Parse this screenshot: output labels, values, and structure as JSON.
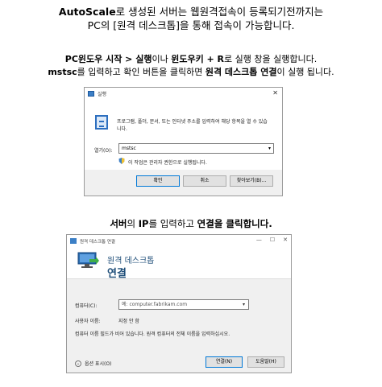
{
  "intro": {
    "line1_bold": "AutoScale",
    "line1_rest": "로 생성된 서버는 웹원격접속이 등록되기전까지는",
    "line2": "PC의 [원격 데스크톱]을 통해 접속이 가능합니다."
  },
  "step1": {
    "p1": "PC윈도우 시작 > 실행",
    "p2": "이나 ",
    "p3": "윈도우키 + R",
    "p4": "로 실행 창을 실행합니다.",
    "p5": "mstsc",
    "p6": "를 입력하고 확인 버튼을 클릭하면 ",
    "p7": "원격 데스크톱 연결",
    "p8": "이 실행 됩니다."
  },
  "run_dialog": {
    "title": "실행",
    "close": "✕",
    "description": "프로그램, 폴더, 문서, 또는 인터넷 주소를 입력하여 해당 항목을 열 수 있습니다.",
    "open_label": "열기(O):",
    "open_value": "mstsc",
    "admin_note": "이 작업은 관리자 권한으로 실행됩니다.",
    "ok": "확인",
    "cancel": "취소",
    "browse": "찾아보기(B)..."
  },
  "step2": {
    "p1": "서버",
    "p2": "의 ",
    "p3": "IP",
    "p4": "를 입력하고 ",
    "p5": "연결을 클릭합니다."
  },
  "rdp_dialog": {
    "title": "원격 데스크톱 연결",
    "minimize": "—",
    "maximize": "☐",
    "close": "✕",
    "heading1": "원격 데스크톱",
    "heading2": "연결",
    "computer_label": "컴퓨터(C):",
    "computer_placeholder": "예: computer.fabrikam.com",
    "user_label": "사용자 이름:",
    "user_value": "지정 안 함",
    "hint": "컴퓨터 이름 필드가 비어 있습니다. 원격 컴퓨터의 전체 이름을 입력하십시오.",
    "options": "옵션 표시(O)",
    "connect": "연결(N)",
    "help": "도움말(H)"
  },
  "colors": {
    "accent": "#1f4e79",
    "button_border": "#0078d7"
  }
}
